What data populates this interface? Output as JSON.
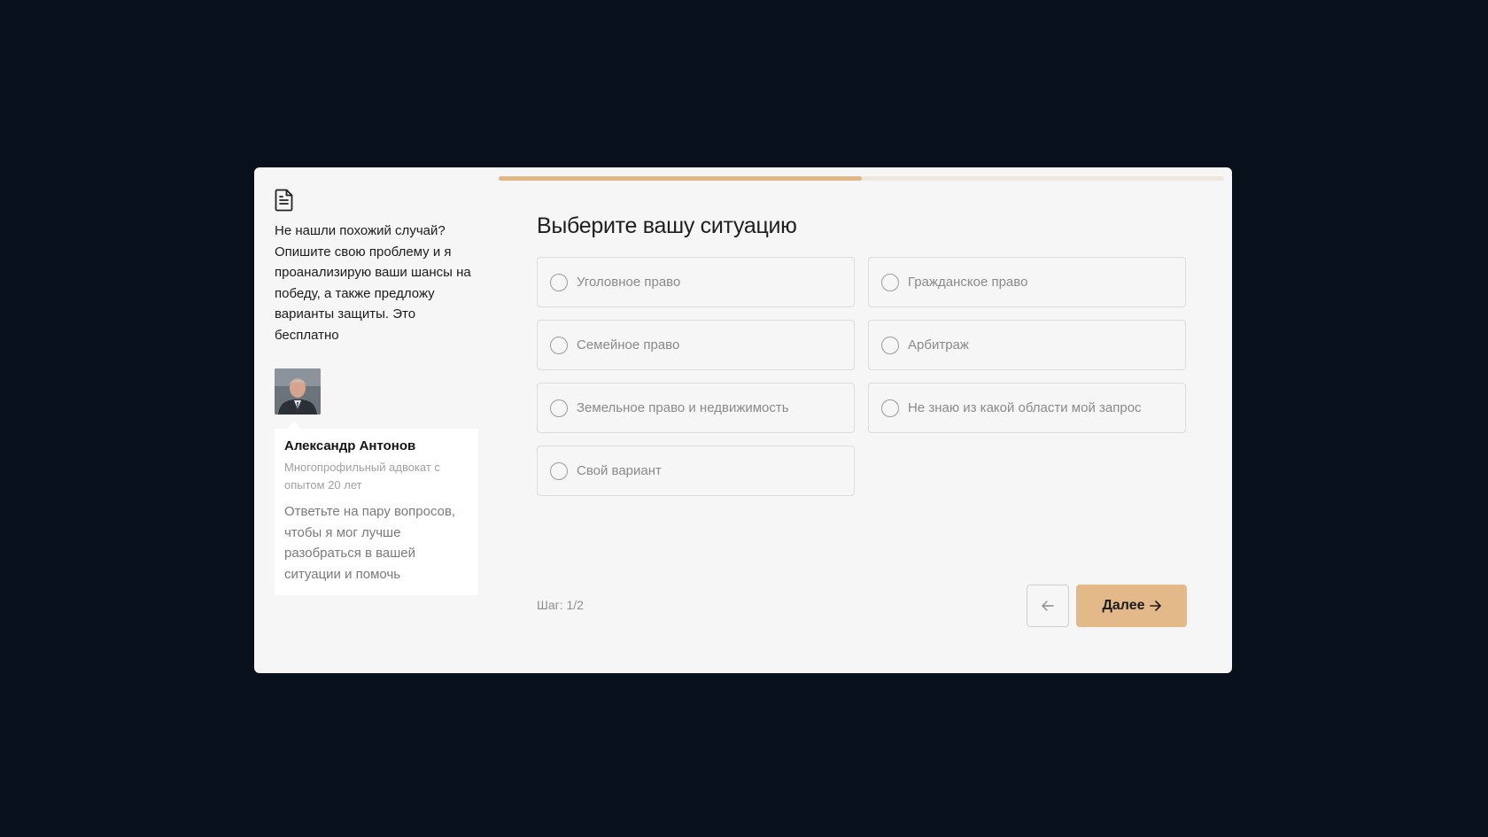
{
  "colors": {
    "backdrop": "#08111b",
    "modal": "#f6f6f6",
    "accent": "#e3b98a",
    "progress_track": "#efe6dc"
  },
  "progress": {
    "fraction": 0.5
  },
  "sidebar": {
    "icon": "document-icon",
    "text": "Не нашли похожий случай? Опишите свою проблему и я проанализирую ваши шансы на победу, а также предложу варианты защиты. Это бесплатно",
    "lawyer": {
      "name": "Александр Антонов",
      "role": "Многопрофильный адвокат с опытом 20 лет",
      "message": "Ответьте на пару вопросов, чтобы я мог лучше разобраться в вашей ситуации и помочь"
    }
  },
  "main": {
    "title": "Выберите вашу ситуацию",
    "options": [
      {
        "label": "Уголовное право"
      },
      {
        "label": "Гражданское право"
      },
      {
        "label": "Семейное право"
      },
      {
        "label": "Арбитраж"
      },
      {
        "label": "Земельное право и недвижимость"
      },
      {
        "label": "Не знаю из какой области мой запрос"
      },
      {
        "label": "Свой вариант"
      }
    ]
  },
  "footer": {
    "step_text": "Шаг: 1/2",
    "back_icon": "arrow-left-icon",
    "next_label": "Далее",
    "next_icon": "arrow-right-icon"
  }
}
